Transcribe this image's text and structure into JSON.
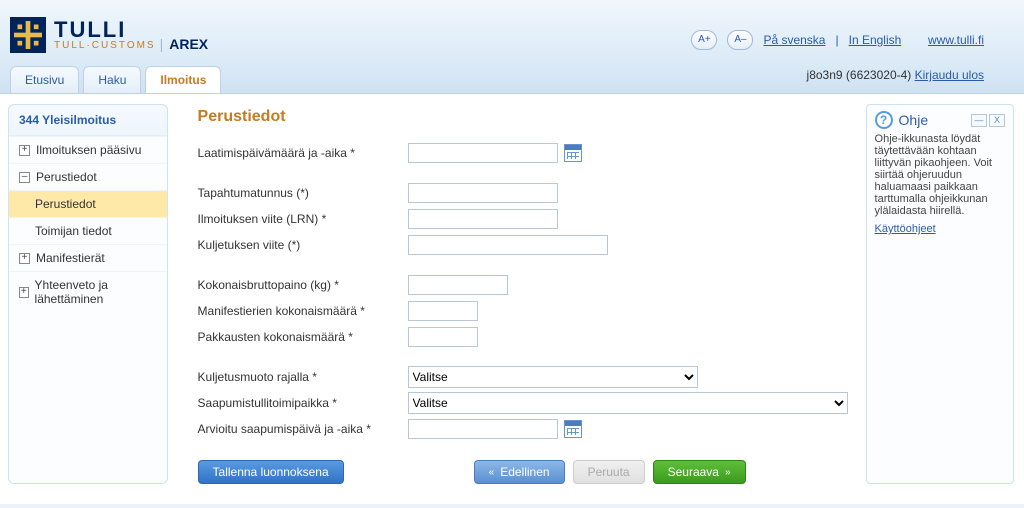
{
  "brand": {
    "main": "TULLI",
    "sub": "TULL·CUSTOMS",
    "app": "AREX",
    "sep": "|"
  },
  "topbar": {
    "font_inc": "A+",
    "font_dec": "A–",
    "lang_sv": "På svenska",
    "lang_en": "In English",
    "site_link": "www.tulli.fi",
    "bar": "|"
  },
  "tabs": {
    "home": "Etusivu",
    "search": "Haku",
    "declare": "Ilmoitus"
  },
  "user": {
    "info": "j8o3n9 (6623020-4)",
    "logout": "Kirjaudu ulos"
  },
  "sidebar": {
    "head": "344 Yleisilmoitus",
    "i0": "Ilmoituksen pääsivu",
    "i1": "Perustiedot",
    "i1a": "Perustiedot",
    "i1b": "Toimijan tiedot",
    "i2": "Manifestierät",
    "i3": "Yhteenveto ja lähettäminen"
  },
  "section_title": "Perustiedot",
  "labels": {
    "date_created": "Laatimispäivämäärä ja -aika *",
    "event_id": "Tapahtumatunnus (*)",
    "lrn": "Ilmoituksen viite (LRN) *",
    "transport_ref": "Kuljetuksen viite (*)",
    "gross_kg": "Kokonaisbruttopaino (kg) *",
    "manifest_total": "Manifestierien kokonaismäärä *",
    "packages_total": "Pakkausten kokonaismäärä *",
    "border_mode": "Kuljetusmuoto rajalla *",
    "arrival_office": "Saapumistullitoimipaikka *",
    "eta": "Arvioitu saapumispäivä ja -aika *"
  },
  "select_placeholder": "Valitse",
  "buttons": {
    "save_draft": "Tallenna luonnoksena",
    "prev": "Edellinen",
    "cancel": "Peruuta",
    "next": "Seuraava"
  },
  "help": {
    "title": "Ohje",
    "body": "Ohje-ikkunasta löydät täytettävään kohtaan liittyvän pikaohjeen. Voit siirtää ohjeruudun haluamaasi paikkaan tarttumalla ohjeikkunan ylälaidasta hiirellä.",
    "link": "Käyttöohjeet"
  }
}
